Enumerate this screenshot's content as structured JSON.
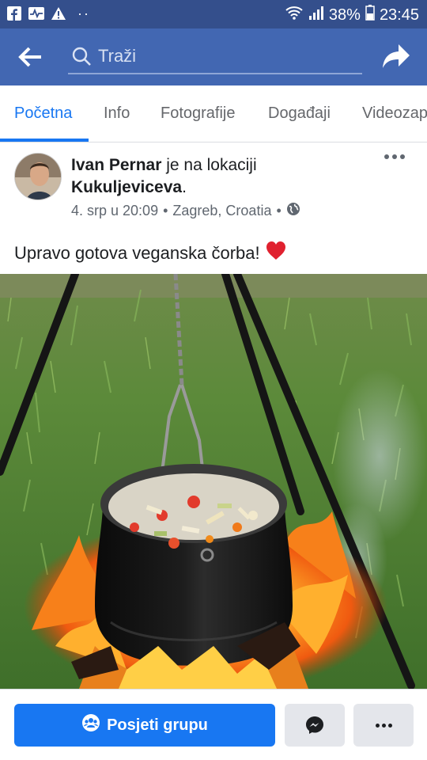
{
  "status_bar": {
    "battery": "38%",
    "time": "23:45",
    "icons": [
      "facebook-icon",
      "activity-icon",
      "warning-icon",
      "wifi-icon",
      "signal-icon",
      "battery-icon"
    ]
  },
  "search": {
    "placeholder": "Traži"
  },
  "tabs": [
    {
      "label": "Početna",
      "active": true
    },
    {
      "label": "Info"
    },
    {
      "label": "Fotografije"
    },
    {
      "label": "Događaji"
    },
    {
      "label": "Videozapisi"
    }
  ],
  "post": {
    "author": "Ivan Pernar",
    "action": " je na lokaciji ",
    "location": "Kukuljeviceva",
    "location_suffix": ".",
    "date": "4. srp u 20:09",
    "place": "Zagreb, Croatia",
    "separator": "•",
    "text": "Upravo gotova veganska čorba!",
    "emoji": "❤️"
  },
  "actions": {
    "visit_label": "Posjeti grupu"
  },
  "colors": {
    "status_bar": "#344f8c",
    "header": "#4267b2",
    "accent": "#1877f2"
  }
}
